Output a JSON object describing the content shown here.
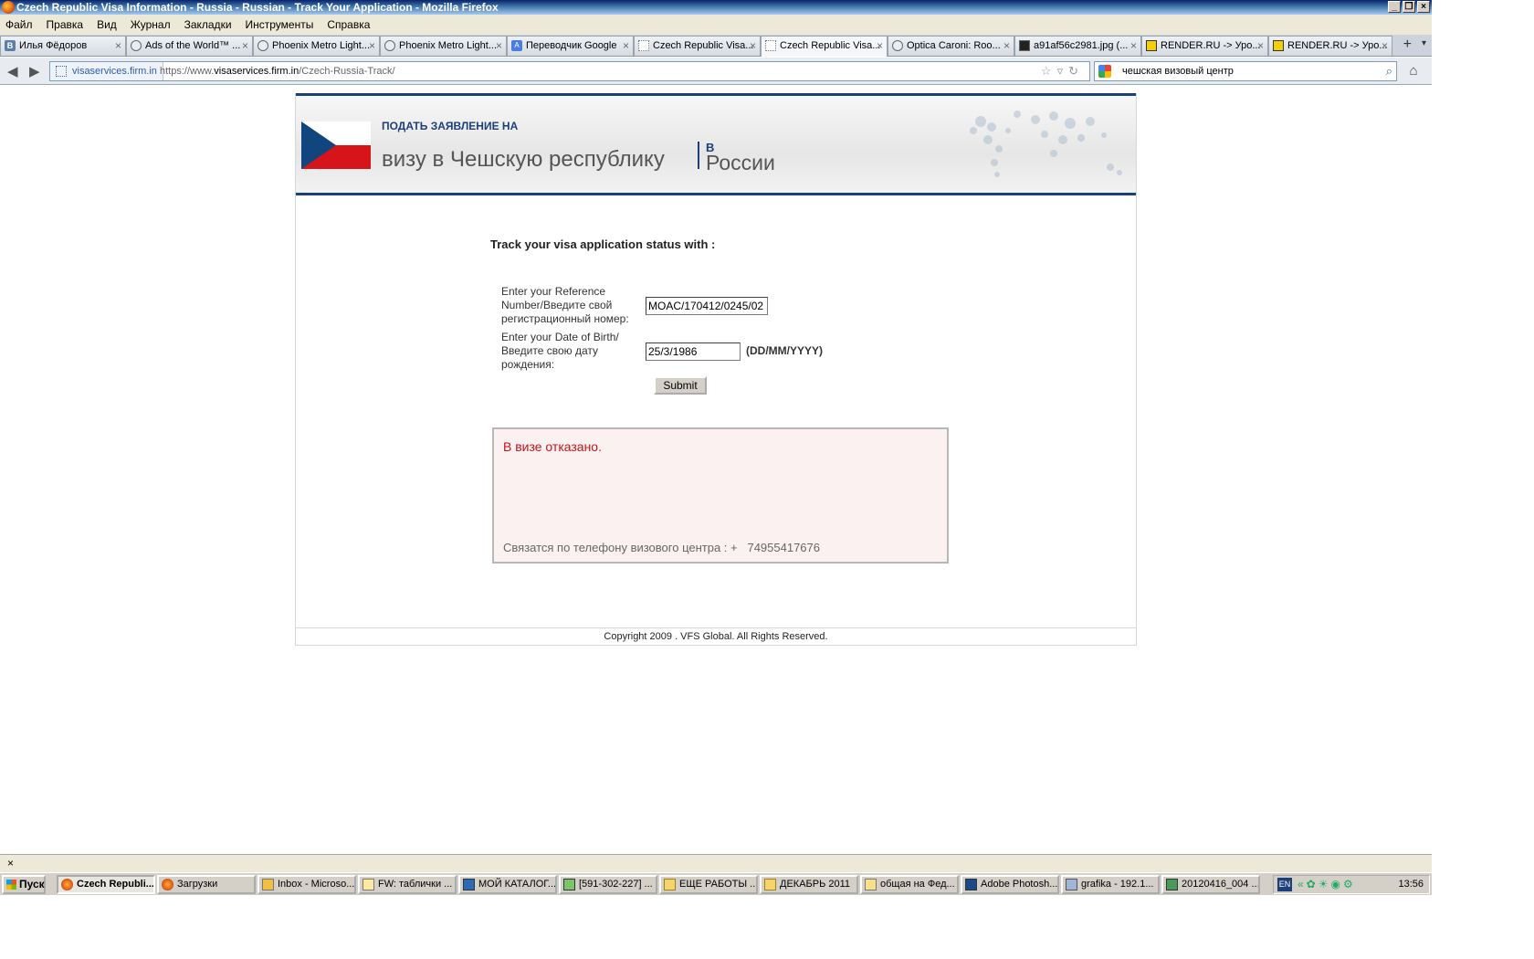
{
  "window": {
    "title": "Czech Republic Visa Information - Russia - Russian - Track Your Application - Mozilla Firefox"
  },
  "menu": [
    "Файл",
    "Правка",
    "Вид",
    "Журнал",
    "Закладки",
    "Инструменты",
    "Справка"
  ],
  "tabs": [
    {
      "label": "Илья Фёдоров",
      "icon": "vk-icon"
    },
    {
      "label": "Ads of the World™ ...",
      "icon": "globe-icon"
    },
    {
      "label": "Phoenix Metro Light...",
      "icon": "globe-icon"
    },
    {
      "label": "Phoenix Metro Light...",
      "icon": "globe-icon"
    },
    {
      "label": "Переводчик Google",
      "icon": "translate-icon"
    },
    {
      "label": "Czech Republic Visa...",
      "icon": "blank-page-icon"
    },
    {
      "label": "Czech Republic Visa...",
      "icon": "blank-page-icon",
      "active": true
    },
    {
      "label": "Optica Caroni: Roo...",
      "icon": "globe-icon"
    },
    {
      "label": "a91af56c2981.jpg (...",
      "icon": "image-icon"
    },
    {
      "label": "RENDER.RU -> Уро...",
      "icon": "render-icon"
    },
    {
      "label": "RENDER.RU -> Уро...",
      "icon": "render-icon"
    }
  ],
  "navbar": {
    "identity": "visaservices.firm.in",
    "url_prefix": "https://www.",
    "url_domain": "visaservices.firm.in",
    "url_path": "/Czech-Russia-Track/",
    "search_value": "чешская визовый центр"
  },
  "header": {
    "apply": "ПОДАТЬ ЗАЯВЛЕНИЕ НА",
    "visa": "визу в Чешскую республику",
    "in": "В",
    "country": "России"
  },
  "form": {
    "heading": "Track your visa application status with :",
    "ref_label": "Enter your Reference Number/Введите свой регистрационный номер:",
    "ref_value": "MOAC/170412/0245/02",
    "dob_label": "Enter your Date of Birth/Введите свою дату рождения:",
    "dob_value": "25/3/1986",
    "dob_format": "(DD/MM/YYYY)",
    "submit": "Submit"
  },
  "result": {
    "status": "В визе отказано.",
    "contact": "Связатся по телефону визового центра : +   74955417676"
  },
  "footer": "Copyright 2009 . VFS Global. All Rights Reserved.",
  "taskbar": {
    "start": "Пуск",
    "items": [
      {
        "label": "Czech Republi...",
        "active": true
      },
      {
        "label": "Загрузки"
      },
      {
        "label": "Inbox - Microso..."
      },
      {
        "label": "FW: таблички ..."
      },
      {
        "label": "МОЙ КАТАЛОГ..."
      },
      {
        "label": "[591-302-227] ..."
      },
      {
        "label": "ЕЩЕ РАБОТЫ ..."
      },
      {
        "label": "ДЕКАБРЬ 2011"
      },
      {
        "label": "общая на Фед..."
      },
      {
        "label": "Adobe Photosh..."
      },
      {
        "label": "grafika - 192.1..."
      },
      {
        "label": "20120416_004 ..."
      }
    ],
    "lang": "EN",
    "clock": "13:56"
  },
  "colors": {
    "brand_blue": "#1c3f7a",
    "refused_red": "#c0141b",
    "result_bg": "#fbf1f1"
  }
}
